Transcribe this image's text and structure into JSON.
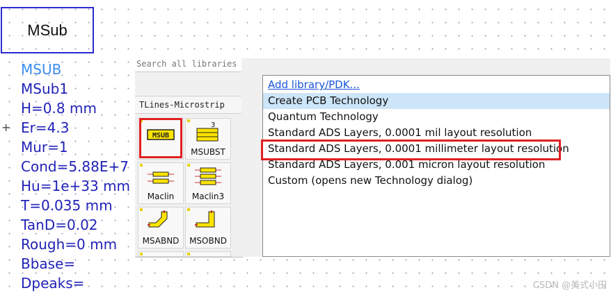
{
  "component_box": {
    "title": "MSub"
  },
  "params": [
    "MSUB",
    "MSub1",
    "H=0.8 mm",
    "Er=4.3",
    "Mur=1",
    "Cond=5.88E+7",
    "Hu=1e+33 mm",
    "T=0.035 mm",
    "TanD=0.02",
    "Rough=0 mm",
    "Bbase=",
    "Dpeaks="
  ],
  "palette": {
    "search_placeholder": "Search all libraries",
    "library_name": "TLines-Microstrip",
    "items": [
      {
        "name": "MSUB",
        "icon": "msub-icon"
      },
      {
        "name": "MSUBST",
        "badge": "3",
        "icon": "msubst-icon"
      },
      {
        "name": "Maclin",
        "icon": "maclin-icon"
      },
      {
        "name": "Maclin3",
        "icon": "maclin3-icon"
      },
      {
        "name": "MSABND",
        "icon": "msabnd-icon"
      },
      {
        "name": "MSOBND",
        "icon": "msobnd-icon"
      }
    ]
  },
  "dropdown": {
    "items": [
      "Add library/PDK...",
      "Create PCB Technology",
      "Quantum Technology",
      "Standard ADS Layers, 0.0001 mil layout resolution",
      "Standard ADS Layers, 0.0001 millimeter layout resolution",
      "Standard ADS Layers, 0.001 micron layout resolution",
      "Custom (opens new Technology dialog)"
    ],
    "selected_index": 1,
    "highlighted_index": 4
  },
  "watermark": "CSDN @美式小田",
  "colors": {
    "param_text": "#2222b8",
    "param_first": "#3a8cf0",
    "highlight": "#e02020",
    "link": "#1a55d6"
  }
}
